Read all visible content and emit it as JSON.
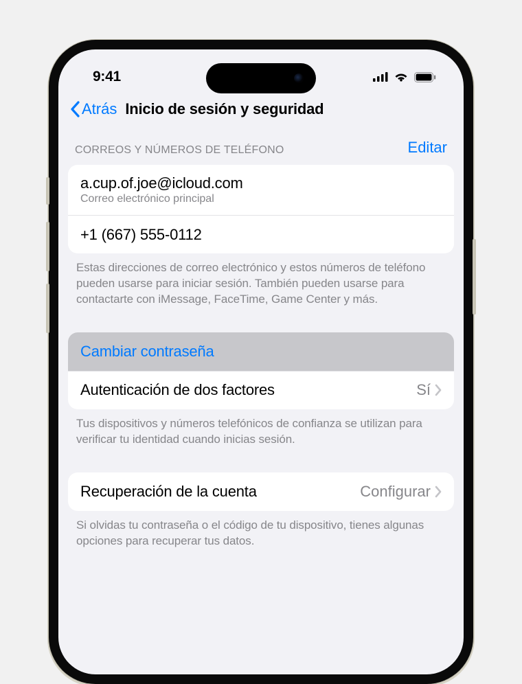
{
  "status": {
    "time": "9:41"
  },
  "nav": {
    "back": "Atrás",
    "title": "Inicio de sesión y seguridad"
  },
  "contacts": {
    "header": "CORREOS Y NÚMEROS DE TELÉFONO",
    "edit": "Editar",
    "email": "a.cup.of.joe@icloud.com",
    "email_sub": "Correo electrónico principal",
    "phone": "+1 (667) 555-0112",
    "footer": "Estas direcciones de correo electrónico y estos números de teléfono pueden usarse para iniciar sesión. También pueden usarse para contactarte con iMessage, FaceTime, Game Center y más."
  },
  "security": {
    "change_password": "Cambiar contraseña",
    "two_factor_label": "Autenticación de dos factores",
    "two_factor_value": "Sí",
    "footer": "Tus dispositivos y números telefónicos de confianza se utilizan para verificar tu identidad cuando inicias sesión."
  },
  "recovery": {
    "label": "Recuperación de la cuenta",
    "value": "Configurar",
    "footer": "Si olvidas tu contraseña o el código de tu dispositivo, tienes algunas opciones para recuperar tus datos."
  },
  "colors": {
    "accent": "#007aff",
    "bg": "#f2f2f6",
    "text_secondary": "#86868a"
  }
}
